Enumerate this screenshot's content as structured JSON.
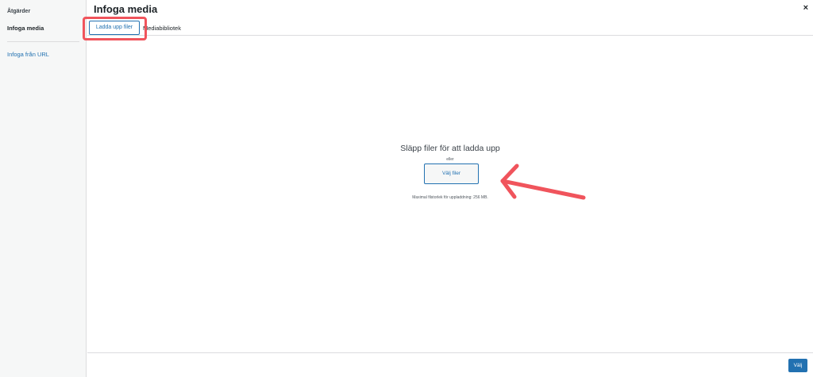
{
  "sidebar": {
    "heading": "Åtgärder",
    "active_item": "Infoga media",
    "link": "Infoga från URL"
  },
  "header": {
    "title": "Infoga media",
    "close_symbol": "×"
  },
  "tabs": {
    "upload": "Ladda upp filer",
    "library": "Mediabibliotek"
  },
  "uploader": {
    "drop_text": "Släpp filer för att ladda upp",
    "or_text": "eller",
    "select_button": "Välj filer",
    "max_size": "Maximal filstorlek för uppladdning: 256 MB."
  },
  "footer": {
    "select_button": "Välj"
  },
  "colors": {
    "accent": "#2271b1",
    "annotation": "#f0545c"
  },
  "annotations": {
    "highlight": "rounded-rectangle",
    "arrow": "arrow-left"
  }
}
